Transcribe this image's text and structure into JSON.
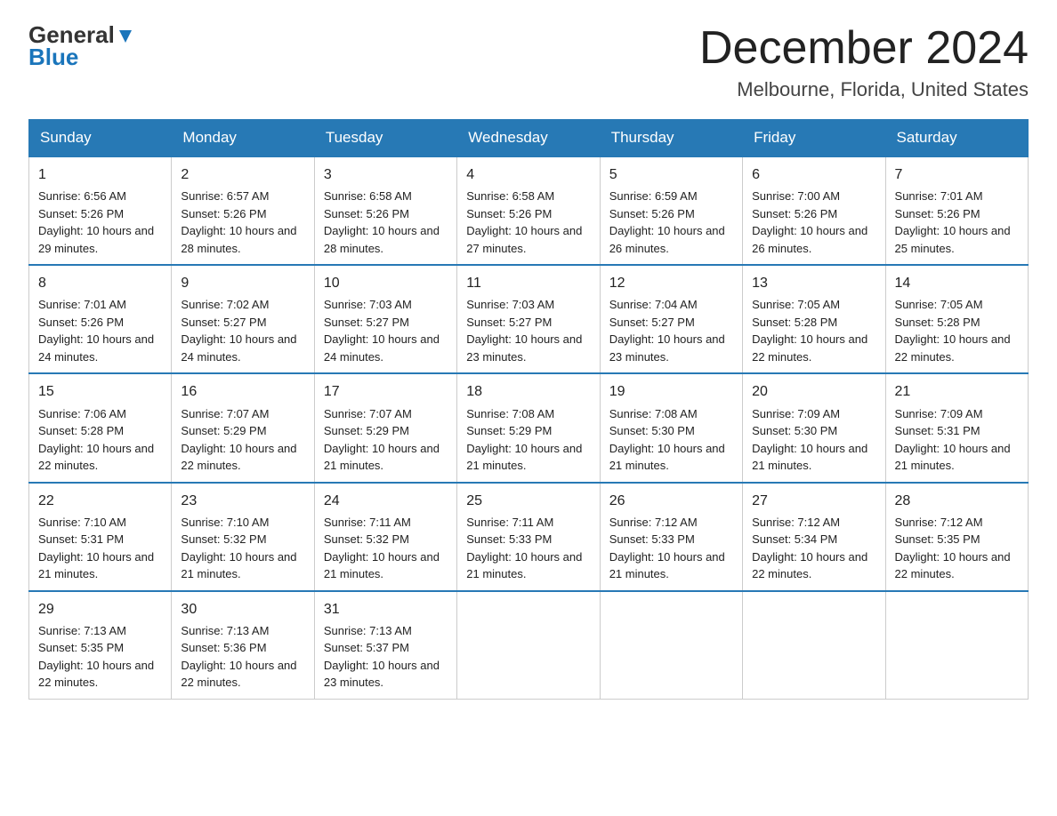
{
  "header": {
    "logo_general": "General",
    "logo_blue": "Blue",
    "title": "December 2024",
    "subtitle": "Melbourne, Florida, United States"
  },
  "weekdays": [
    "Sunday",
    "Monday",
    "Tuesday",
    "Wednesday",
    "Thursday",
    "Friday",
    "Saturday"
  ],
  "weeks": [
    [
      {
        "day": "1",
        "sunrise": "6:56 AM",
        "sunset": "5:26 PM",
        "daylight": "10 hours and 29 minutes."
      },
      {
        "day": "2",
        "sunrise": "6:57 AM",
        "sunset": "5:26 PM",
        "daylight": "10 hours and 28 minutes."
      },
      {
        "day": "3",
        "sunrise": "6:58 AM",
        "sunset": "5:26 PM",
        "daylight": "10 hours and 28 minutes."
      },
      {
        "day": "4",
        "sunrise": "6:58 AM",
        "sunset": "5:26 PM",
        "daylight": "10 hours and 27 minutes."
      },
      {
        "day": "5",
        "sunrise": "6:59 AM",
        "sunset": "5:26 PM",
        "daylight": "10 hours and 26 minutes."
      },
      {
        "day": "6",
        "sunrise": "7:00 AM",
        "sunset": "5:26 PM",
        "daylight": "10 hours and 26 minutes."
      },
      {
        "day": "7",
        "sunrise": "7:01 AM",
        "sunset": "5:26 PM",
        "daylight": "10 hours and 25 minutes."
      }
    ],
    [
      {
        "day": "8",
        "sunrise": "7:01 AM",
        "sunset": "5:26 PM",
        "daylight": "10 hours and 24 minutes."
      },
      {
        "day": "9",
        "sunrise": "7:02 AM",
        "sunset": "5:27 PM",
        "daylight": "10 hours and 24 minutes."
      },
      {
        "day": "10",
        "sunrise": "7:03 AM",
        "sunset": "5:27 PM",
        "daylight": "10 hours and 24 minutes."
      },
      {
        "day": "11",
        "sunrise": "7:03 AM",
        "sunset": "5:27 PM",
        "daylight": "10 hours and 23 minutes."
      },
      {
        "day": "12",
        "sunrise": "7:04 AM",
        "sunset": "5:27 PM",
        "daylight": "10 hours and 23 minutes."
      },
      {
        "day": "13",
        "sunrise": "7:05 AM",
        "sunset": "5:28 PM",
        "daylight": "10 hours and 22 minutes."
      },
      {
        "day": "14",
        "sunrise": "7:05 AM",
        "sunset": "5:28 PM",
        "daylight": "10 hours and 22 minutes."
      }
    ],
    [
      {
        "day": "15",
        "sunrise": "7:06 AM",
        "sunset": "5:28 PM",
        "daylight": "10 hours and 22 minutes."
      },
      {
        "day": "16",
        "sunrise": "7:07 AM",
        "sunset": "5:29 PM",
        "daylight": "10 hours and 22 minutes."
      },
      {
        "day": "17",
        "sunrise": "7:07 AM",
        "sunset": "5:29 PM",
        "daylight": "10 hours and 21 minutes."
      },
      {
        "day": "18",
        "sunrise": "7:08 AM",
        "sunset": "5:29 PM",
        "daylight": "10 hours and 21 minutes."
      },
      {
        "day": "19",
        "sunrise": "7:08 AM",
        "sunset": "5:30 PM",
        "daylight": "10 hours and 21 minutes."
      },
      {
        "day": "20",
        "sunrise": "7:09 AM",
        "sunset": "5:30 PM",
        "daylight": "10 hours and 21 minutes."
      },
      {
        "day": "21",
        "sunrise": "7:09 AM",
        "sunset": "5:31 PM",
        "daylight": "10 hours and 21 minutes."
      }
    ],
    [
      {
        "day": "22",
        "sunrise": "7:10 AM",
        "sunset": "5:31 PM",
        "daylight": "10 hours and 21 minutes."
      },
      {
        "day": "23",
        "sunrise": "7:10 AM",
        "sunset": "5:32 PM",
        "daylight": "10 hours and 21 minutes."
      },
      {
        "day": "24",
        "sunrise": "7:11 AM",
        "sunset": "5:32 PM",
        "daylight": "10 hours and 21 minutes."
      },
      {
        "day": "25",
        "sunrise": "7:11 AM",
        "sunset": "5:33 PM",
        "daylight": "10 hours and 21 minutes."
      },
      {
        "day": "26",
        "sunrise": "7:12 AM",
        "sunset": "5:33 PM",
        "daylight": "10 hours and 21 minutes."
      },
      {
        "day": "27",
        "sunrise": "7:12 AM",
        "sunset": "5:34 PM",
        "daylight": "10 hours and 22 minutes."
      },
      {
        "day": "28",
        "sunrise": "7:12 AM",
        "sunset": "5:35 PM",
        "daylight": "10 hours and 22 minutes."
      }
    ],
    [
      {
        "day": "29",
        "sunrise": "7:13 AM",
        "sunset": "5:35 PM",
        "daylight": "10 hours and 22 minutes."
      },
      {
        "day": "30",
        "sunrise": "7:13 AM",
        "sunset": "5:36 PM",
        "daylight": "10 hours and 22 minutes."
      },
      {
        "day": "31",
        "sunrise": "7:13 AM",
        "sunset": "5:37 PM",
        "daylight": "10 hours and 23 minutes."
      },
      null,
      null,
      null,
      null
    ]
  ]
}
